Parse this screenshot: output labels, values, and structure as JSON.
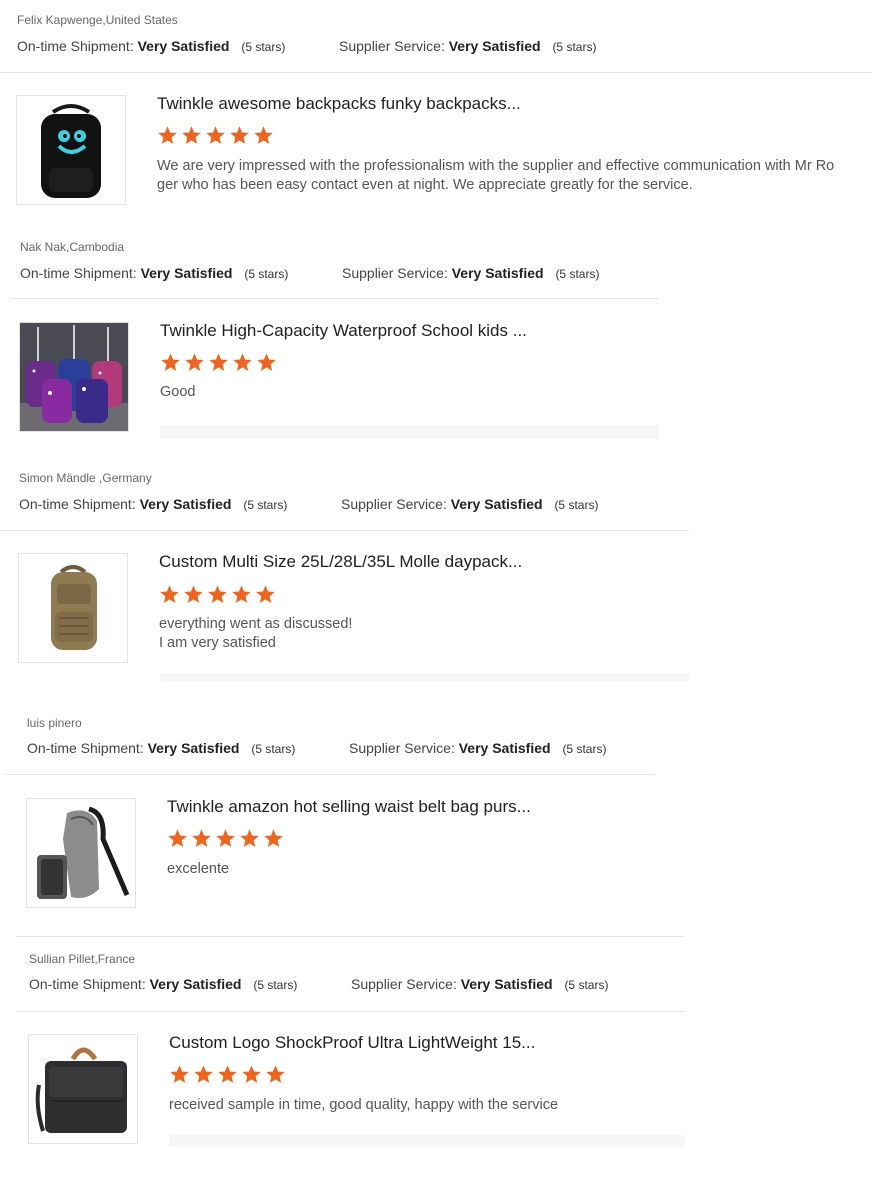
{
  "rating_labels": {
    "shipment": "On-time Shipment:",
    "service": "Supplier Service:"
  },
  "colors": {
    "star": "#f0641e",
    "divider": "#e6e6e6"
  },
  "reviews": [
    {
      "reviewer": "Felix Kapwenge,United States",
      "shipment_value": "Very Satisfied",
      "shipment_stars": "(5 stars)",
      "service_value": "Very Satisfied",
      "service_stars": "(5 stars)",
      "product_title": "Twinkle awesome backpacks funky backpacks...",
      "product_image": "black-backpack-icon",
      "rating": 5,
      "comment_lines": [
        "We are very impressed with the professionalism with the supplier and effective communication with Mr Ro",
        "ger who has been easy contact even at night. We appreciate greatly for the service."
      ]
    },
    {
      "reviewer": "Nak Nak,Cambodia",
      "shipment_value": "Very Satisfied",
      "shipment_stars": "(5 stars)",
      "service_value": "Very Satisfied",
      "service_stars": "(5 stars)",
      "product_title": "Twinkle High-Capacity Waterproof School kids ...",
      "product_image": "galaxy-trolley-bags-icon",
      "rating": 5,
      "comment_lines": [
        "Good"
      ]
    },
    {
      "reviewer": "Simon Mändle ,Germany",
      "shipment_value": "Very Satisfied",
      "shipment_stars": "(5 stars)",
      "service_value": "Very Satisfied",
      "service_stars": "(5 stars)",
      "product_title": "Custom Multi Size 25L/28L/35L Molle daypack...",
      "product_image": "tan-molle-backpack-icon",
      "rating": 5,
      "comment_lines": [
        "everything went as discussed!",
        "I am very satisfied"
      ]
    },
    {
      "reviewer": "luis pinero",
      "shipment_value": "Very Satisfied",
      "shipment_stars": "(5 stars)",
      "service_value": "Very Satisfied",
      "service_stars": "(5 stars)",
      "product_title": "Twinkle amazon hot selling waist belt bag purs...",
      "product_image": "sling-bag-icon",
      "rating": 5,
      "comment_lines": [
        "excelente"
      ]
    },
    {
      "reviewer": "Sullian Pillet,France",
      "shipment_value": "Very Satisfied",
      "shipment_stars": "(5 stars)",
      "service_value": "Very Satisfied",
      "service_stars": "(5 stars)",
      "product_title": "Custom Logo ShockProof Ultra LightWeight 15...",
      "product_image": "laptop-bag-icon",
      "rating": 5,
      "comment_lines": [
        "received sample in time, good quality, happy with the service"
      ]
    }
  ]
}
